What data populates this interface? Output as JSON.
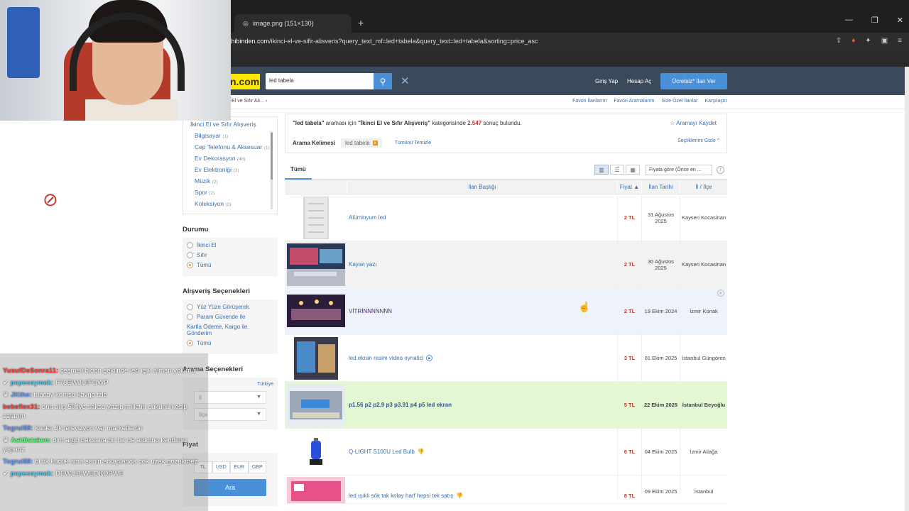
{
  "browser": {
    "tab_title": "image.png (151×130)",
    "url_domain": "sahibinden.com",
    "url_path": "/ikinci-el-ve-sifir-alisveris?query_text_mf=led+tabela&query_text=led+tabela&sorting=price_asc"
  },
  "header": {
    "logo_text": "n.com",
    "search_value": "led tabela",
    "login": "Giriş Yap",
    "signup": "Hesap Aç",
    "post_ad": "Ücretsiz* İlan Ver"
  },
  "subnav": {
    "breadcrumb": "El ve Sıfır Alı... ›",
    "links": [
      "Favori İlanlarım",
      "Favori Aramalarım",
      "Size Özel İlanlar",
      "Karşılaştır"
    ]
  },
  "filters": {
    "category_title": "İkinci El ve Sıfır Alışveriş",
    "categories": [
      {
        "label": "Bilgisayar",
        "count": "(1)"
      },
      {
        "label": "Cep Telefonu & Aksesuar",
        "count": "(1)"
      },
      {
        "label": "Ev Dekorasyon",
        "count": "(46)"
      },
      {
        "label": "Ev Elektroniği",
        "count": "(3)"
      },
      {
        "label": "Müzik",
        "count": "(2)"
      },
      {
        "label": "Spor",
        "count": "(2)"
      },
      {
        "label": "Koleksiyon",
        "count": "(3)"
      }
    ],
    "condition_title": "Durumu",
    "condition_options": [
      "İkinci El",
      "Sıfır",
      "Tümü"
    ],
    "shopping_title": "Alışveriş Seçenekleri",
    "shopping_options": [
      "Yüz Yüze Görüşerek",
      "Param Güvende ile",
      "Tümü"
    ],
    "shopping_sub": "Kartla Ödeme, Kargo ile Gönderim",
    "search_options_title": "Arama Seçenekleri",
    "country": "Türkiye",
    "city_placeholder": "İl",
    "district_placeholder": "İlçe",
    "price_title": "Fiyat",
    "currencies": [
      "TL",
      "USD",
      "EUR",
      "GBP"
    ],
    "search_button": "Ara"
  },
  "results": {
    "summary_query": "\"led tabela\"",
    "summary_mid": " araması için ",
    "summary_cat": "\"İkinci El ve Sıfır Alışveriş\"",
    "summary_mid2": " kategorisinde ",
    "summary_count": "2.547",
    "summary_end": " sonuç bulundu.",
    "save_search": "Aramayı Kaydet",
    "keyword_label": "Arama Kelimesi",
    "keyword_chip": "led tabela",
    "clear_all": "Tümünü Temizle",
    "hide_selections": "Seçtiklerimi Gizle",
    "tab_all": "Tümü",
    "sort_value": "Fiyata göre (Önce en ...",
    "columns": {
      "title": "İlan Başlığı",
      "price": "Fiyat ▲",
      "date": "İlan Tarihi",
      "location": "İl / İlçe"
    },
    "rows": [
      {
        "title": "Alüminyum led",
        "price": "2 TL",
        "date": "31 Ağustos 2025",
        "location": "Kayseri Kocasinan"
      },
      {
        "title": "Kayan yazı",
        "price": "2 TL",
        "date": "30 Ağustos 2025",
        "location": "Kayseri Kocasinan"
      },
      {
        "title": "VİTRİNNNNNNN",
        "price": "2 TL",
        "date": "19 Ekim 2024",
        "location": "İzmir Konak"
      },
      {
        "title": "led ekran resim video oynatici",
        "price": "3 TL",
        "date": "01 Ekim 2025",
        "location": "İstanbul Güngören"
      },
      {
        "title": "p1.56 p2 p2.9 p3 p3.91 p4 p5 led ekran",
        "price": "5 TL",
        "date": "22 Ekim 2025",
        "location": "İstanbul Beyoğlu"
      },
      {
        "title": "Q-LIGHT S100U Led Bulb",
        "price": "6 TL",
        "date": "04 Ekim 2025",
        "location": "İzmir Aliağa"
      },
      {
        "title": "led ışıklı sök tak kolay harf hepsi tek satış",
        "price": "8 TL",
        "date": "09 Ekim 2025",
        "location": "İstanbul"
      }
    ]
  },
  "chat": [
    {
      "user": "YusufDeSonra11:",
      "text": " çeşmeli bidon şeklinde led ışık alman yok mu",
      "color": "#ff3b3b"
    },
    {
      "user": "pepeeoymak:",
      "text": " F78EWJUIFOWP",
      "color": "#3fd0ff"
    },
    {
      "user": "JKthe:",
      "text": " tuncay komşu kavga izle",
      "color": "#6aa0ff"
    },
    {
      "user": "bebeflex31:",
      "text": " onu alıp 50tlye sakso yazıp milletin çükünü kesip satarım",
      "color": "#ff3b3b"
    },
    {
      "user": "Togrul88:",
      "text": " kanka 3k televizyon var marketlerde",
      "color": "#6aa0ff"
    },
    {
      "user": "Asidistaken:",
      "text": " olm argb baksana bir bir de arduino kendimiz yaparız",
      "color": "#5bff7a"
    },
    {
      "user": "Togrul88:",
      "text": " bi tik kucuk ama senin arkaplanda cok uzak gozukmez",
      "color": "#6aa0ff"
    },
    {
      "user": "pepeeoymak:",
      "text": " DEWUDIWEOKDPWE",
      "color": "#3fd0ff"
    }
  ]
}
